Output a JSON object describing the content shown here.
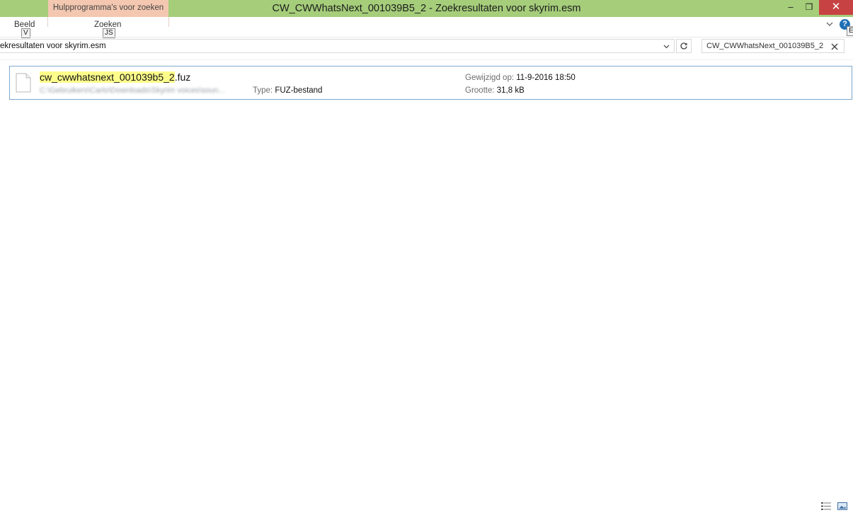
{
  "window": {
    "context_tab": "Hulpprogramma's voor zoeken",
    "title": "CW_CWWhatsNext_001039B5_2 - Zoekresultaten voor skyrim.esm",
    "minimize": "‒",
    "maximize": "❐",
    "close": "✕"
  },
  "ribbon": {
    "tabs": [
      {
        "label": "Beeld",
        "keytip": "V"
      },
      {
        "label": "Zoeken",
        "keytip": "JS"
      }
    ],
    "expand_keytip": "E",
    "help": "?"
  },
  "address": {
    "path": "ekresultaten voor skyrim.esm"
  },
  "search": {
    "value": "CW_CWWhatsNext_001039B5_2"
  },
  "results": [
    {
      "name_highlight": "cw_cwwhatsnext_001039b5_2",
      "name_ext": ".fuz",
      "path": "C:\\Gebruikers\\Carlo\\Downloads\\Skyrim voices\\soun...",
      "type_label": "Type:",
      "type_value": "FUZ-bestand",
      "modified_label": "Gewijzigd op:",
      "modified_value": "11-9-2016 18:50",
      "size_label": "Grootte:",
      "size_value": "31,8 kB"
    }
  ],
  "colors": {
    "titlebar": "#a5cd7a",
    "context_tab": "#f3c7b0",
    "close": "#c74343",
    "highlight": "#fdfd8c",
    "selection_border": "#7ea8d0"
  }
}
